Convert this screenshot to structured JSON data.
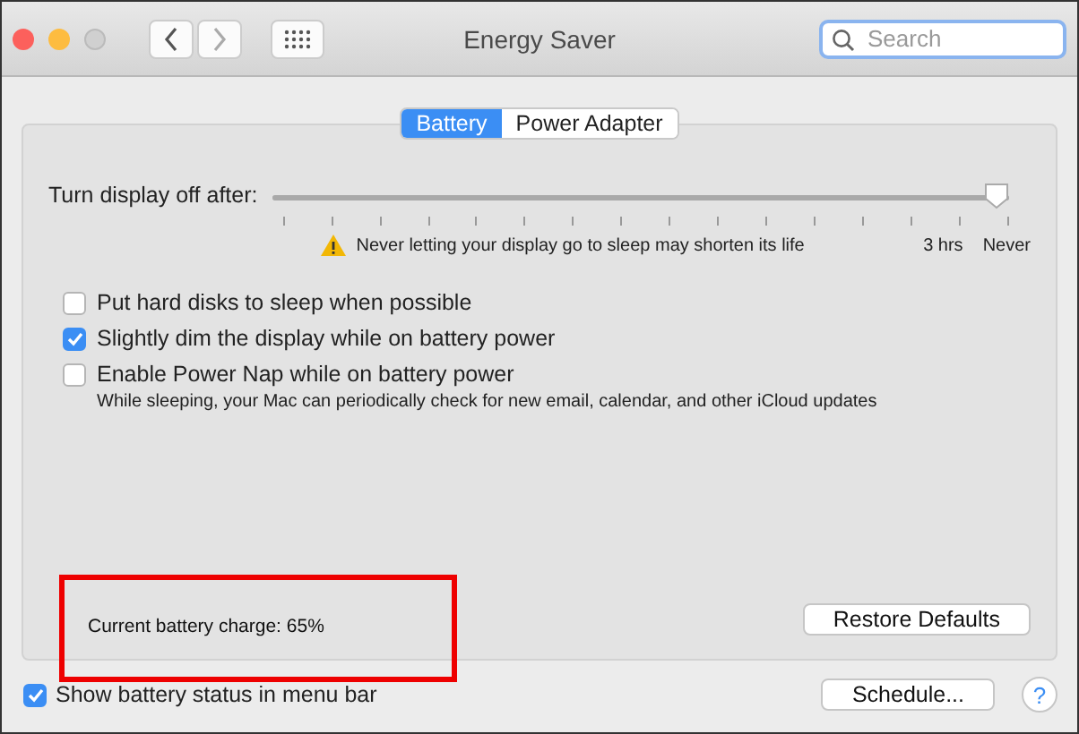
{
  "window": {
    "title": "Energy Saver"
  },
  "search": {
    "placeholder": "Search"
  },
  "tabs": [
    {
      "label": "Battery",
      "selected": true
    },
    {
      "label": "Power Adapter",
      "selected": false
    }
  ],
  "display_sleep": {
    "label": "Turn display off after:",
    "level": 1,
    "warning": "Never letting your display go to sleep may shorten its life",
    "tick_labels": [
      "3 hrs",
      "Never"
    ]
  },
  "options": [
    {
      "label": "Put hard disks to sleep when possible",
      "checked": false
    },
    {
      "label": "Slightly dim the display while on battery power",
      "checked": true
    },
    {
      "label": "Enable Power Nap while on battery power",
      "checked": false,
      "note": "While sleeping, your Mac can periodically check for new email, calendar, and other iCloud updates"
    }
  ],
  "battery_charge": "Current battery charge: 65%",
  "restore_button": "Restore Defaults",
  "show_status": {
    "label": "Show battery status in menu bar",
    "checked": true
  },
  "schedule_button": "Schedule...",
  "help": "?"
}
